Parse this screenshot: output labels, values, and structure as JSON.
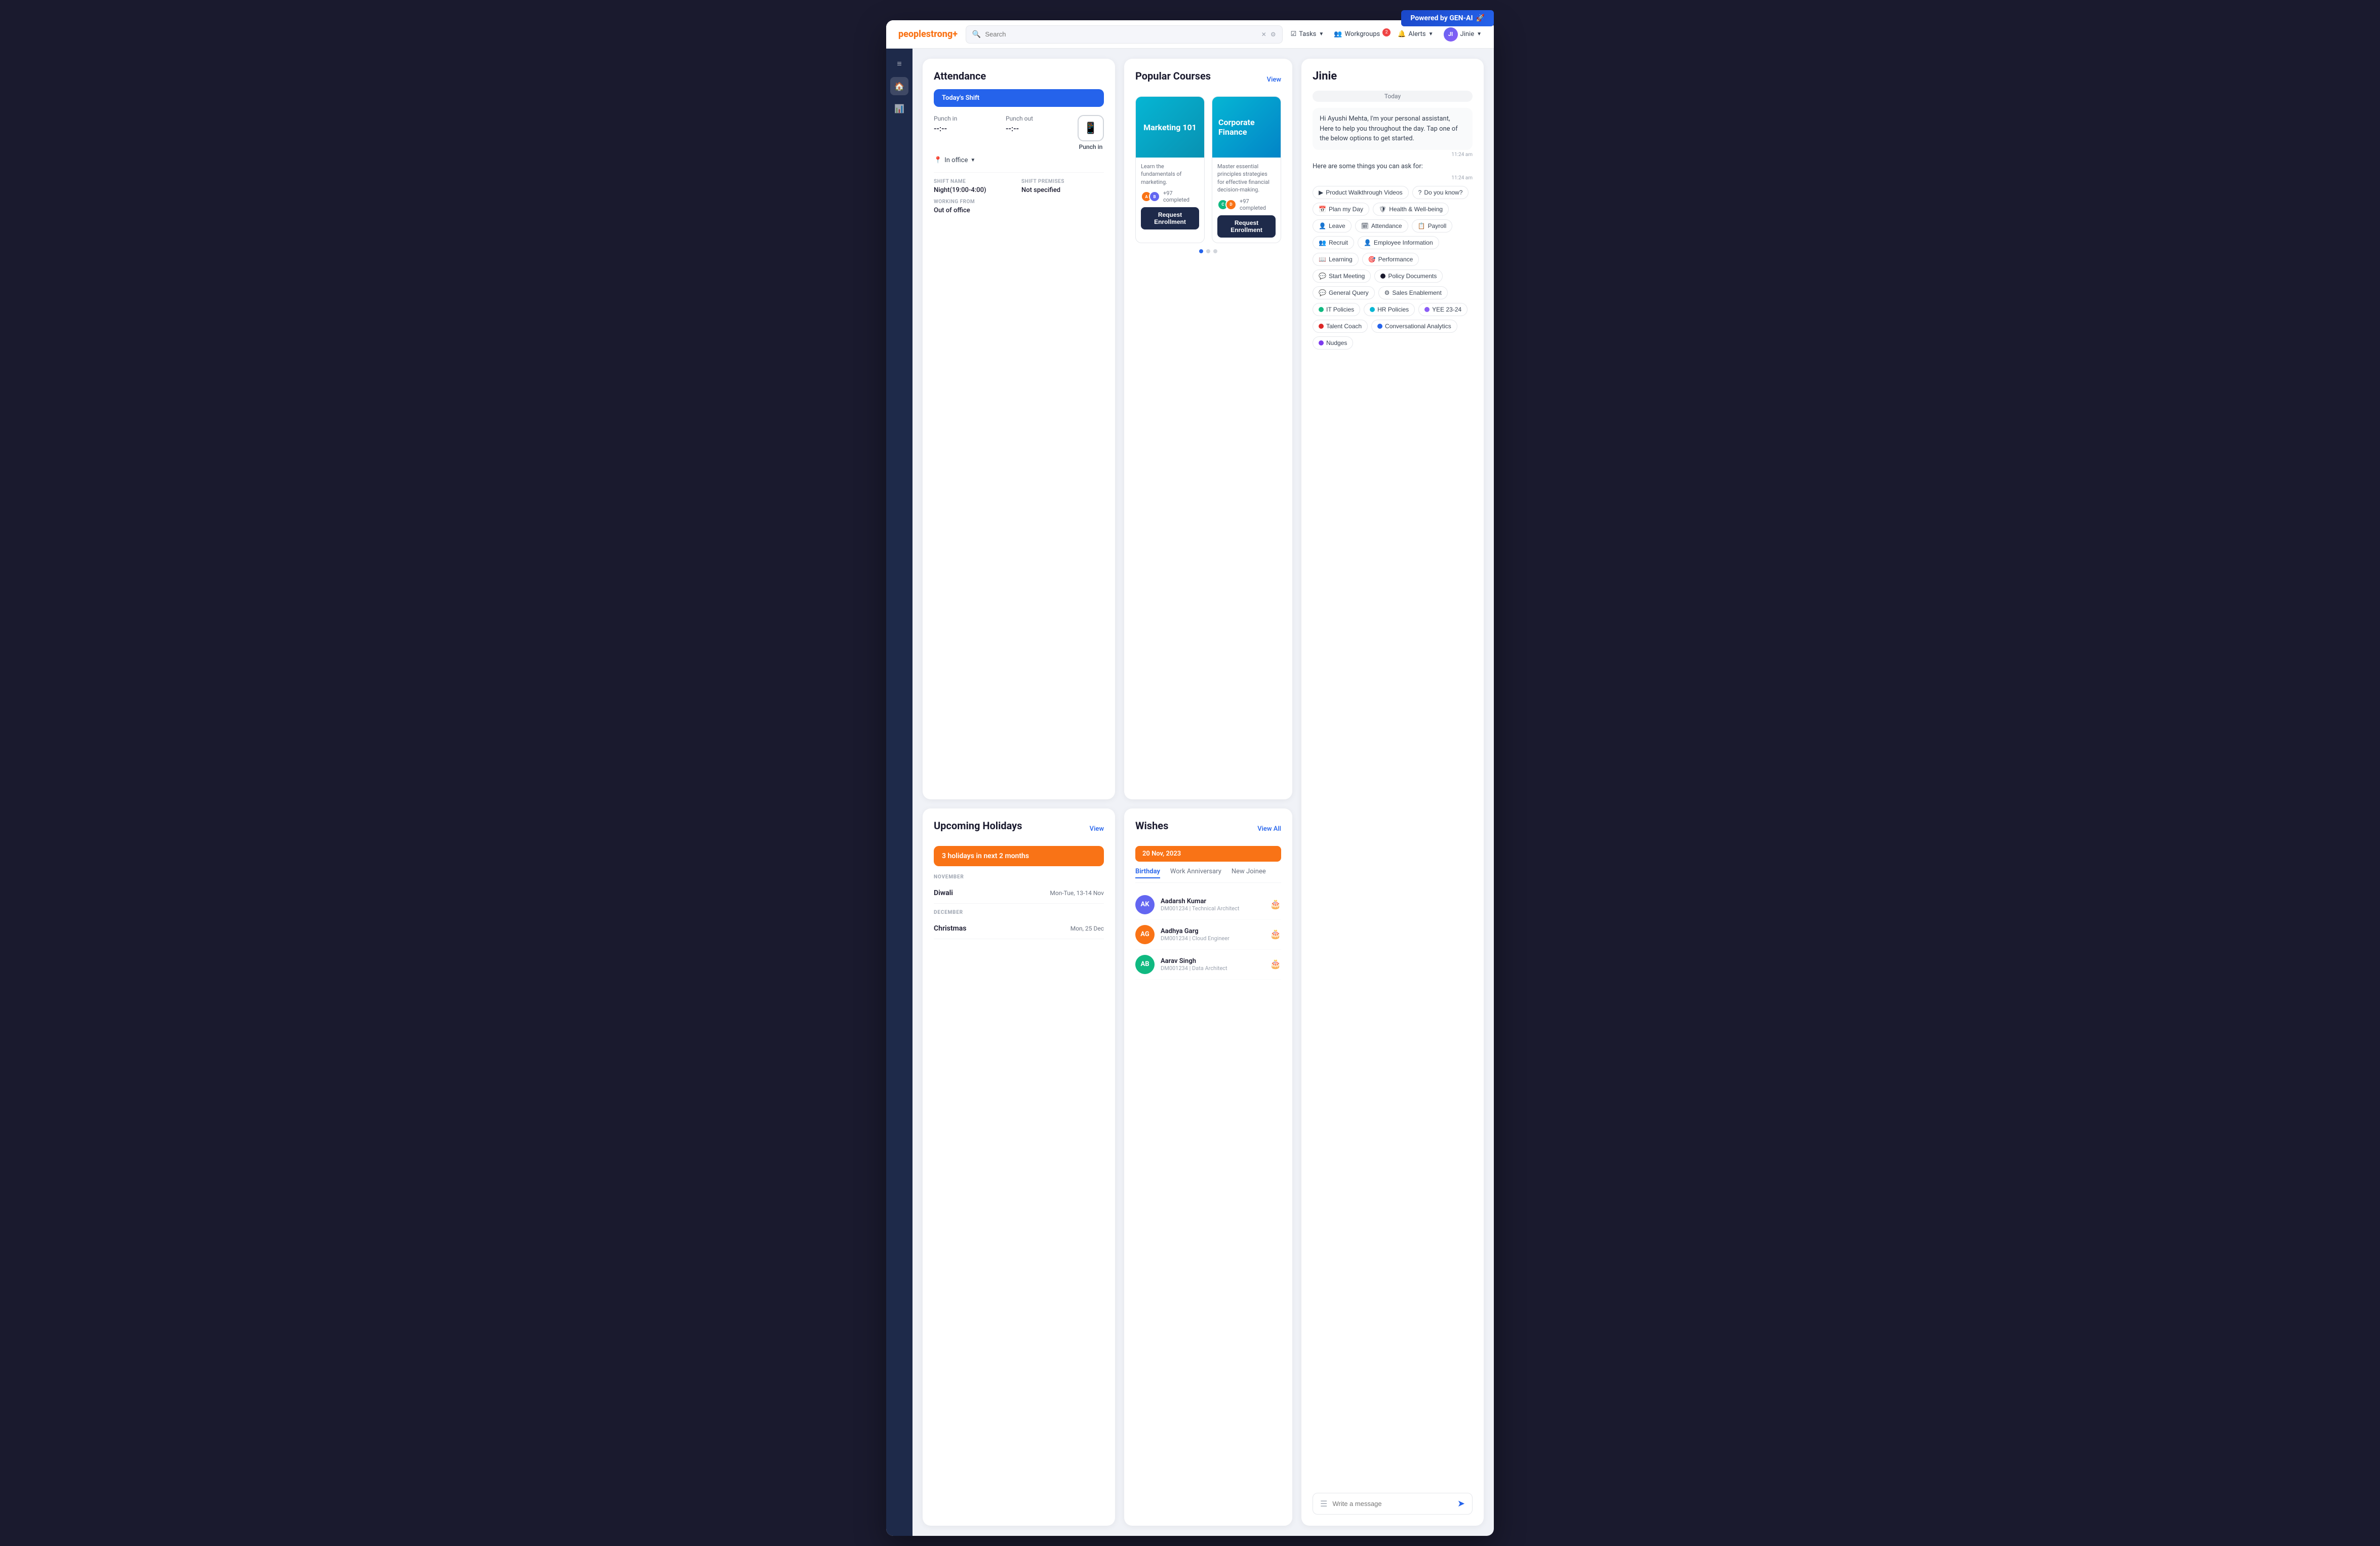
{
  "banner": {
    "text": "Powered by GEN-AI",
    "emoji": "🚀"
  },
  "nav": {
    "logo": "peoplestrong",
    "logo_accent": "+",
    "search_placeholder": "Search",
    "tasks_label": "Tasks",
    "workgroups_label": "Workgroups",
    "workgroups_badge": "2",
    "alerts_label": "Alerts",
    "user_label": "Jinie",
    "user_initials": "JI"
  },
  "sidebar": {
    "icons": [
      "≡",
      "🏠",
      "📊"
    ]
  },
  "attendance": {
    "title": "Attendance",
    "shift_label": "Today's Shift",
    "punch_in_label": "Punch in",
    "punch_in_time": "--:--",
    "punch_out_label": "Punch out",
    "punch_out_time": "--:--",
    "punch_btn_label": "Punch in",
    "location_label": "In office",
    "shift_name_label": "SHIFT NAME",
    "shift_name_value": "Night(19:00-4:00)",
    "shift_premises_label": "SHIFT PREMISES",
    "shift_premises_value": "Not specified",
    "working_from_label": "WORKING FROM",
    "working_from_value": "Out of office"
  },
  "holidays": {
    "title": "Upcoming Holidays",
    "view_label": "View",
    "banner_text": "3 holidays in next 2 months",
    "items": [
      {
        "month": "NOVEMBER",
        "name": "Diwali",
        "date": "Mon-Tue, 13-14 Nov"
      },
      {
        "month": "DECEMBER",
        "name": "Christmas",
        "date": "Mon, 25 Dec"
      }
    ]
  },
  "courses": {
    "title": "Popular  Courses",
    "view_label": "View",
    "items": [
      {
        "name": "Marketing 101",
        "theme": "marketing",
        "description": "Learn the fundamentals of marketing.",
        "completed_count": "+97",
        "completed_label": "completed",
        "enroll_label": "Request Enrollment"
      },
      {
        "name": "Corporate Finance",
        "theme": "finance",
        "description": "Master essential principles strategies for effective financial decision-making.",
        "completed_count": "+97",
        "completed_label": "completed",
        "enroll_label": "Request Enrollment"
      }
    ]
  },
  "wishes": {
    "title": "Wishes",
    "view_all_label": "View All",
    "date_banner": "20 Nov, 2023",
    "tabs": [
      {
        "label": "Birthday",
        "active": true
      },
      {
        "label": "Work Anniversary",
        "active": false
      },
      {
        "label": "New Joinee",
        "active": false
      }
    ],
    "items": [
      {
        "initials": "AK",
        "color": "#6366f1",
        "name": "Aadarsh Kumar",
        "meta": "DM001234 | Technical Architect"
      },
      {
        "initials": "AG",
        "color": "#f97316",
        "name": "Aadhya Garg",
        "meta": "DM001234 | Cloud Engineer"
      },
      {
        "initials": "AB",
        "color": "#10b981",
        "name": "Aarav Singh",
        "meta": "DM001234 | Data Architect"
      }
    ]
  },
  "jinie": {
    "title": "Jinie",
    "today_label": "Today",
    "greeting": "Hi Ayushi Mehta, I'm your personal assistant, Here to help you throughout the day. Tap one of the below options to get started.",
    "greeting_time": "11:24 am",
    "ask_label": "Here are some things you can ask for:",
    "ask_time": "11:24 am",
    "quick_btns": [
      {
        "label": "Product Walkthrough Videos",
        "icon": "▶",
        "dot_color": ""
      },
      {
        "label": "Do you know?",
        "icon": "?",
        "dot_color": ""
      },
      {
        "label": "Plan my Day",
        "icon": "📅",
        "dot_color": ""
      },
      {
        "label": "Health & Well-being",
        "icon": "🛡",
        "dot_color": ""
      },
      {
        "label": "Leave",
        "icon": "👤",
        "dot_color": ""
      },
      {
        "label": "Attendance",
        "icon": "🗓",
        "dot_color": ""
      },
      {
        "label": "Payroll",
        "icon": "📋",
        "dot_color": ""
      },
      {
        "label": "Recruit",
        "icon": "👥",
        "dot_color": ""
      },
      {
        "label": "Employee Information",
        "icon": "👤",
        "dot_color": ""
      },
      {
        "label": "Learning",
        "icon": "📖",
        "dot_color": ""
      },
      {
        "label": "Performance",
        "icon": "🎯",
        "dot_color": ""
      },
      {
        "label": "Start Meeting",
        "icon": "💬",
        "dot_color": ""
      },
      {
        "label": "Policy Documents",
        "icon": "⚫",
        "dot_color": "#1a1a2e"
      },
      {
        "label": "General Query",
        "icon": "💬",
        "dot_color": ""
      },
      {
        "label": "Sales Enablement",
        "icon": "⚙",
        "dot_color": ""
      },
      {
        "label": "IT Policies",
        "icon": "🟢",
        "dot_color": "#10b981"
      },
      {
        "label": "HR Policies",
        "icon": "🔵",
        "dot_color": "#06b6d4"
      },
      {
        "label": "YEE 23-24",
        "icon": "🟣",
        "dot_color": "#8b5cf6"
      },
      {
        "label": "Talent Coach",
        "icon": "🔴",
        "dot_color": "#dc2626"
      },
      {
        "label": "Conversational Analytics",
        "icon": "🔵",
        "dot_color": "#2563eb"
      },
      {
        "label": "Nudges",
        "icon": "🟣",
        "dot_color": "#7c3aed"
      }
    ],
    "input_placeholder": "Write a message"
  }
}
